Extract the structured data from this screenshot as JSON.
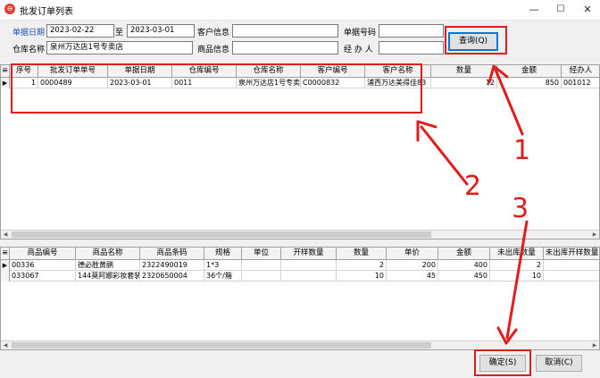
{
  "window": {
    "title": "批发订单列表",
    "min_glyph": "—",
    "max_glyph": "☐",
    "close_glyph": "✕",
    "icon_name": "app-logo-icon"
  },
  "filters": {
    "date_label": "单据日期",
    "date_from": "2023-02-22",
    "to_label": "至",
    "date_to": "2023-03-01",
    "customer_label": "客户信息",
    "customer_value": "",
    "doc_no_label": "单据号码",
    "doc_no_value": "",
    "warehouse_label": "仓库名称",
    "warehouse_value": "泉州万达店1号专卖店",
    "product_label": "商品信息",
    "product_value": "",
    "handler_label": "经 办 人",
    "handler_value": "",
    "query_label": "查询(Q)"
  },
  "orders": {
    "columns": [
      "序号",
      "批发订单单号",
      "单据日期",
      "仓库编号",
      "仓库名称",
      "客户编号",
      "客户名称",
      "数量",
      "金额",
      "经办人"
    ],
    "rows": [
      [
        "1",
        "0000489",
        "2023-03-01",
        "0011",
        "泉州万达店1号专卖",
        "C0000832",
        "浦西万达美得佳83",
        "12",
        "850",
        "001012"
      ]
    ]
  },
  "items": {
    "columns": [
      "商品编号",
      "商品名称",
      "商品条码",
      "规格",
      "单位",
      "开样数量",
      "数量",
      "单价",
      "金额",
      "未出库数量",
      "未出库开样数量"
    ],
    "rows": [
      [
        "00336",
        "德必胜黄鹂",
        "2322490019",
        "1*3",
        "",
        "",
        "2",
        "200",
        "400",
        "2",
        ""
      ],
      [
        "033067",
        "144莫阿娜彩妆套装",
        "2320650004",
        "36个/箱",
        "",
        "",
        "10",
        "45",
        "450",
        "10",
        ""
      ]
    ]
  },
  "footer": {
    "confirm_label": "确定(S)",
    "cancel_label": "取消(C)"
  },
  "annotations": {
    "num1": "1",
    "num2": "2",
    "num3": "3",
    "color": "#e21b1b"
  }
}
